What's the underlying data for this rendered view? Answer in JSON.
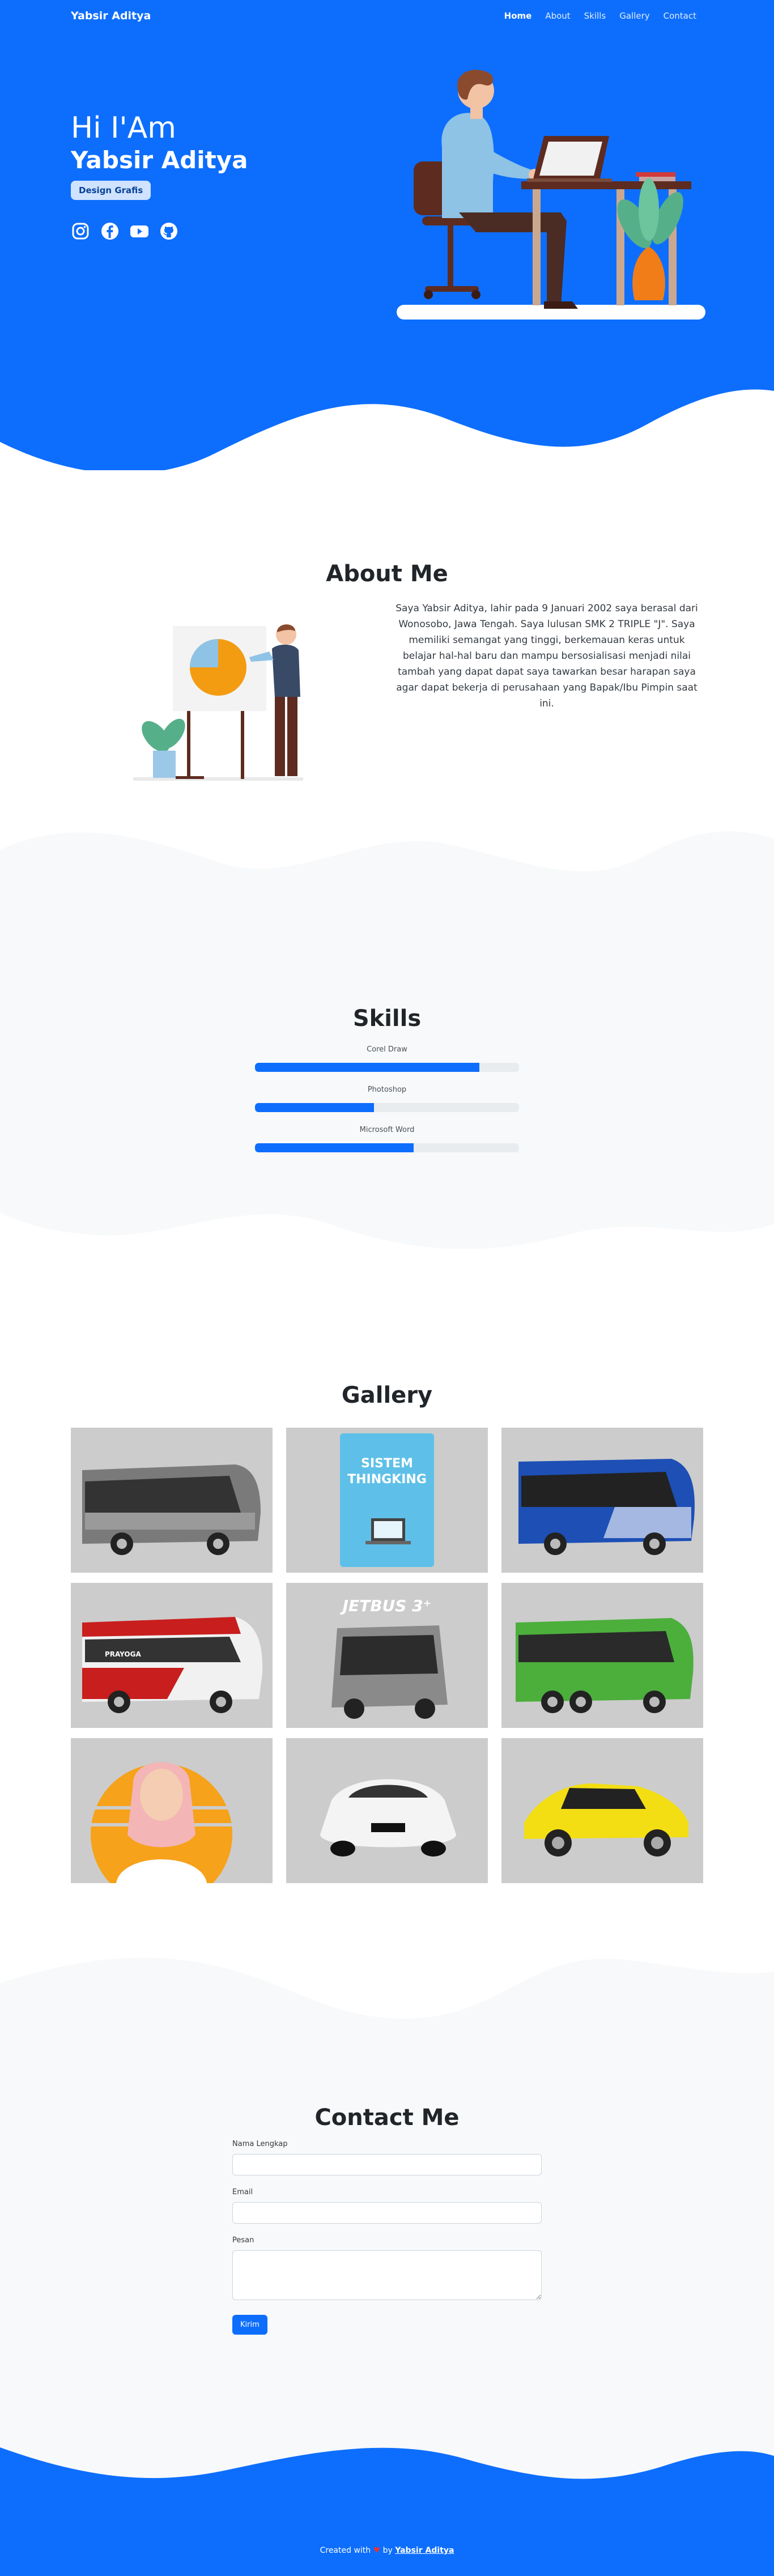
{
  "nav": {
    "brand": "Yabsir Aditya",
    "items": [
      {
        "label": "Home",
        "active": true
      },
      {
        "label": "About",
        "active": false
      },
      {
        "label": "Skills",
        "active": false
      },
      {
        "label": "Gallery",
        "active": false
      },
      {
        "label": "Contact",
        "active": false
      }
    ]
  },
  "hero": {
    "greeting": "Hi I'Am",
    "name": "Yabsir Aditya",
    "badge": "Design Grafis",
    "socials": [
      "instagram-icon",
      "facebook-icon",
      "youtube-icon",
      "github-icon"
    ]
  },
  "about": {
    "title": "About Me",
    "text": "Saya Yabsir Aditya, lahir pada 9 Januari 2002 saya berasal dari Wonosobo, Jawa Tengah. Saya lulusan SMK 2 TRIPLE \"J\". Saya memiliki semangat yang tinggi, berkemauan keras untuk belajar hal-hal baru dan mampu bersosialisasi menjadi nilai tambah yang dapat dapat saya tawarkan besar harapan saya agar dapat bekerja di perusahaan yang Bapak/Ibu Pimpin saat ini."
  },
  "skills": {
    "title": "Skills",
    "items": [
      {
        "label": "Corel Draw",
        "level": 0.85
      },
      {
        "label": "Photoshop",
        "level": 0.45
      },
      {
        "label": "Microsoft Word",
        "level": 0.6
      }
    ]
  },
  "gallery": {
    "title": "Gallery",
    "items": [
      {
        "subject": "grey-bus"
      },
      {
        "subject": "poster",
        "caption_line1": "SISTEM",
        "caption_line2": "THINGKING"
      },
      {
        "subject": "blue-bus"
      },
      {
        "subject": "red-bus",
        "brand_text": "PRAYOGA"
      },
      {
        "subject": "jetbus-poster",
        "caption": "JETBUS 3⁺"
      },
      {
        "subject": "green-bus"
      },
      {
        "subject": "portrait"
      },
      {
        "subject": "white-car"
      },
      {
        "subject": "yellow-car"
      }
    ]
  },
  "contact": {
    "title": "Contact Me",
    "fields": {
      "name_label": "Nama Lengkap",
      "email_label": "Email",
      "message_label": "Pesan"
    },
    "submit_label": "Kirim"
  },
  "footer": {
    "prefix": "Created with",
    "heart": "♥",
    "by": "by",
    "author": "Yabsir Aditya"
  },
  "colors": {
    "primary": "#0d6efd",
    "light_bg": "#f8f9fa",
    "badge_bg": "#cfe2ff"
  }
}
